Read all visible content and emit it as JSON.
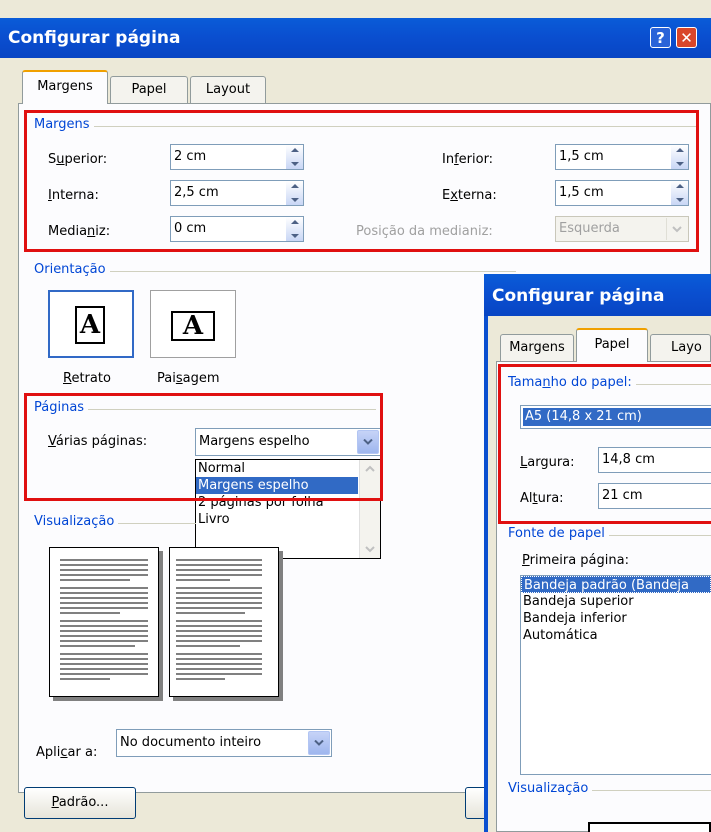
{
  "main_dialog": {
    "title": "Configurar página",
    "help_icon": "question-mark-icon",
    "close_icon": "close-icon",
    "tabs": [
      {
        "label": "Margens",
        "active": true
      },
      {
        "label": "Papel",
        "active": false
      },
      {
        "label": "Layout",
        "active": false
      }
    ],
    "margins": {
      "group_title": "Margens",
      "superior_label": "Superior:",
      "superior_value": "2 cm",
      "inferior_label": "Inferior:",
      "inferior_value": "1,5 cm",
      "interna_label": "Interna:",
      "interna_value": "2,5 cm",
      "externa_label": "Externa:",
      "externa_value": "1,5 cm",
      "medianiz_label": "Medianiz:",
      "medianiz_value": "0 cm",
      "posicao_label": "Posição da medianiz:",
      "posicao_value": "Esquerda"
    },
    "orientation": {
      "group_title": "Orientação",
      "portrait_label": "Retrato",
      "landscape_label": "Paisagem",
      "page_letter": "A",
      "selected": "Retrato"
    },
    "pages": {
      "group_title": "Páginas",
      "multiple_label": "Várias páginas:",
      "selected_value": "Margens espelho",
      "options": [
        "Normal",
        "Margens espelho",
        "2 páginas por folha",
        "Livro"
      ]
    },
    "preview": {
      "group_title": "Visualização",
      "apply_label": "Aplicar a:",
      "apply_value": "No documento inteiro"
    },
    "default_button": "Padrão..."
  },
  "second_dialog": {
    "title": "Configurar página",
    "tabs": [
      {
        "label": "Margens",
        "active": false
      },
      {
        "label": "Papel",
        "active": true
      },
      {
        "label": "Layo",
        "active": false
      }
    ],
    "paper_size": {
      "group_title": "Tamanho do papel:",
      "selected_size": "A5 (14,8 x 21 cm)",
      "width_label": "Largura:",
      "width_value": "14,8 cm",
      "height_label": "Altura:",
      "height_value": "21 cm"
    },
    "paper_source": {
      "group_title": "Fonte de papel",
      "first_page_label": "Primeira página:",
      "options": [
        "Bandeja padrão (Bandeja",
        "Bandeja superior",
        "Bandeja inferior",
        "Automática"
      ],
      "selected_index": 0
    },
    "preview_title": "Visualização"
  },
  "colors": {
    "titlebar": "#0a4fd0",
    "highlight_box": "#e01010",
    "group_title": "#0046d5",
    "selection": "#316ac5"
  }
}
